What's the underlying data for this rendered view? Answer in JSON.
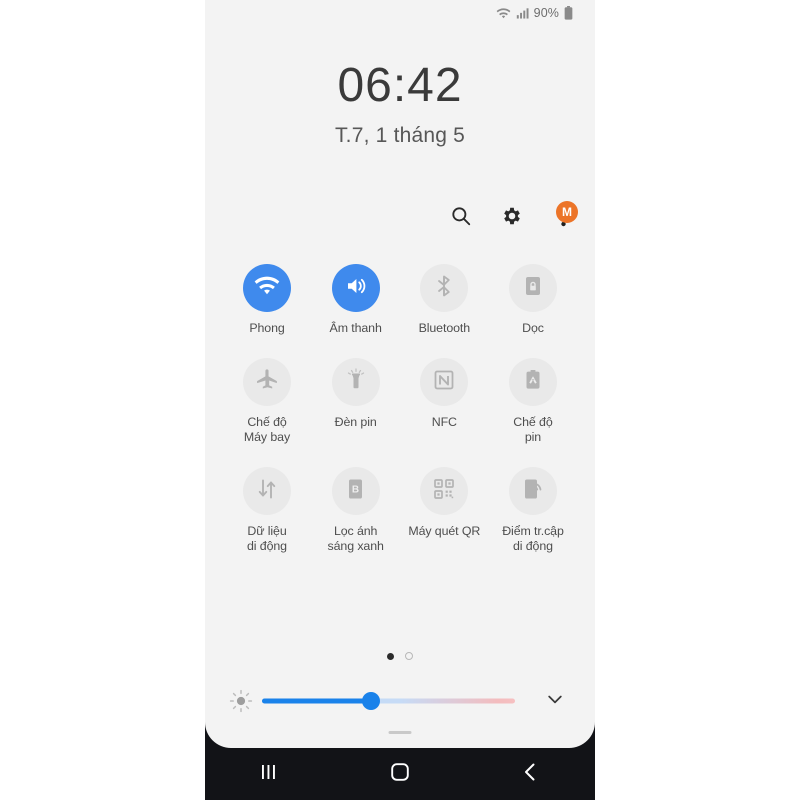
{
  "statusbar": {
    "wifi_icon": "wifi-icon",
    "signal_icon": "cellular-signal-icon",
    "battery_percent": "90%",
    "battery_icon": "battery-icon"
  },
  "clock": {
    "time": "06:42",
    "date": "T.7, 1 tháng 5"
  },
  "header_actions": {
    "search_label": "search-icon",
    "settings_label": "gear-icon",
    "more_label": "overflow-menu-icon",
    "badge_text": "M",
    "badge_color": "#ec7428"
  },
  "quick_settings": {
    "rows": [
      [
        {
          "label": "Phong",
          "icon": "wifi-icon",
          "active": true
        },
        {
          "label": "Âm thanh",
          "icon": "sound-icon",
          "active": true
        },
        {
          "label": "Bluetooth",
          "icon": "bluetooth-icon",
          "active": false
        },
        {
          "label": "Dọc",
          "icon": "rotation-lock-icon",
          "active": false
        }
      ],
      [
        {
          "label": "Chế độ\nMáy bay",
          "icon": "airplane-icon",
          "active": false
        },
        {
          "label": "Đèn pin",
          "icon": "flashlight-icon",
          "active": false
        },
        {
          "label": "NFC",
          "icon": "nfc-icon",
          "active": false
        },
        {
          "label": "Chế độ\npin",
          "icon": "battery-saver-icon",
          "active": false
        }
      ],
      [
        {
          "label": "Dữ liệu\ndi động",
          "icon": "mobile-data-icon",
          "active": false
        },
        {
          "label": "Lọc ánh\nsáng xanh",
          "icon": "blue-light-filter-icon",
          "active": false
        },
        {
          "label": "Máy quét QR",
          "icon": "qr-scanner-icon",
          "active": false
        },
        {
          "label": "Điểm tr.cập\ndi động",
          "icon": "mobile-hotspot-icon",
          "active": false
        }
      ]
    ],
    "active_color": "#3f8aed",
    "inactive_color": "#e9e9e9"
  },
  "page_indicator": {
    "total": 2,
    "current": 1
  },
  "brightness": {
    "icon": "brightness-icon",
    "value_percent": 43,
    "expand_icon": "chevron-down-icon",
    "fill_color": "#1a82ea"
  },
  "navbar": {
    "recents_label": "recents-icon",
    "home_label": "home-icon",
    "back_label": "back-icon"
  }
}
